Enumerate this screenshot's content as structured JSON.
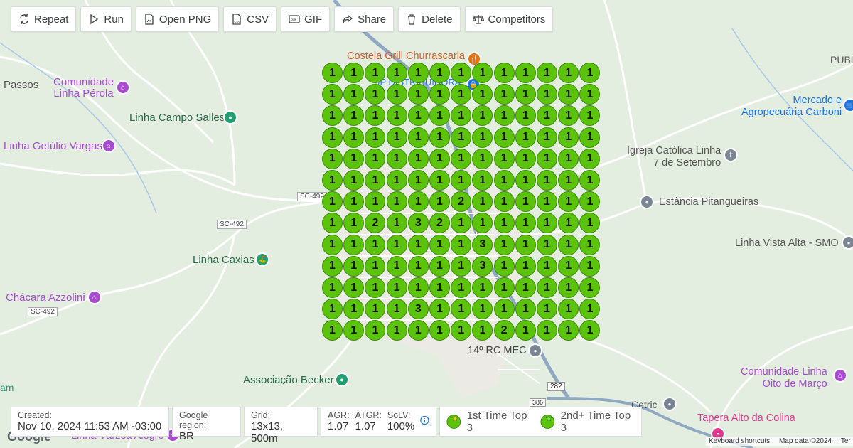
{
  "toolbar": {
    "repeat": "Repeat",
    "run": "Run",
    "open_png": "Open PNG",
    "csv": "CSV",
    "gif": "GIF",
    "share": "Share",
    "delete": "Delete",
    "competitors": "Competitors"
  },
  "map_labels": {
    "costela": "Costela Grill Churrascaria",
    "jp": "JP DISTRIBUIDORA",
    "comunidade_perola_1": "Comunidade",
    "comunidade_perola_2": "Linha Pérola",
    "passos": "Passos",
    "campo_salles": "Linha Campo Salles",
    "getulio": "Linha Getúlio Vargas",
    "caxias": "Linha Caxias",
    "chacara": "Chácara Azzolini",
    "sc492_a": "SC-492",
    "sc492_b": "SC-492",
    "sc492_c": "SC-492",
    "mercado_1": "Mercado e",
    "mercado_2": "Agropecuária Carboni",
    "igreja_1": "Igreja Católica Linha",
    "igreja_2": "7 de Setembro",
    "pitangueiras": "Estância Pitangueiras",
    "vista_alta": "Linha Vista Alta - SMO",
    "publi": "PUBL",
    "rc_mec": "14º RC MEC",
    "becker": "Associação Becker",
    "oito_marco_1": "Comunidade Linha",
    "oito_marco_2": "Oito de Março",
    "cetric": "Cetric",
    "tapera": "Tapera Alto da Colina",
    "varzea": "Linha Várzea Alegre",
    "am": "am",
    "road_282": "282",
    "road_386": "386",
    "google": "Google",
    "shortcuts": "Keyboard shortcuts",
    "mapdata": "Map data ©2024",
    "terms": "Ter"
  },
  "info": {
    "created_label": "Created:",
    "created_value": "Nov 10, 2024 11:53 AM -03:00",
    "region_label": "Google region:",
    "region_value": "BR",
    "grid_label": "Grid:",
    "grid_value": "13x13, 500m",
    "agr_label": "AGR:",
    "agr_value": "1.07",
    "atgr_label": "ATGR:",
    "atgr_value": "1.07",
    "solv_label": "SoLV:",
    "solv_value": "100%",
    "legend_first": "1st Time Top 3",
    "legend_second": "2nd+ Time Top 3"
  },
  "grid": {
    "cols": 13,
    "rows": 13,
    "pin_color": "#5cc30c",
    "ranks": [
      [
        1,
        1,
        1,
        1,
        1,
        1,
        1,
        1,
        1,
        1,
        1,
        1,
        1
      ],
      [
        1,
        1,
        1,
        1,
        1,
        1,
        1,
        1,
        1,
        1,
        1,
        1,
        1
      ],
      [
        1,
        1,
        1,
        1,
        1,
        1,
        1,
        1,
        1,
        1,
        1,
        1,
        1
      ],
      [
        1,
        1,
        1,
        1,
        1,
        1,
        1,
        1,
        1,
        1,
        1,
        1,
        1
      ],
      [
        1,
        1,
        1,
        1,
        1,
        1,
        1,
        1,
        1,
        1,
        1,
        1,
        1
      ],
      [
        1,
        1,
        1,
        1,
        1,
        1,
        1,
        1,
        1,
        1,
        1,
        1,
        1
      ],
      [
        1,
        1,
        1,
        1,
        1,
        1,
        2,
        1,
        1,
        1,
        1,
        1,
        1
      ],
      [
        1,
        1,
        2,
        1,
        3,
        2,
        1,
        1,
        1,
        1,
        1,
        1,
        1
      ],
      [
        1,
        1,
        1,
        1,
        1,
        1,
        1,
        3,
        1,
        1,
        1,
        1,
        1
      ],
      [
        1,
        1,
        1,
        1,
        1,
        1,
        1,
        3,
        1,
        1,
        1,
        1,
        1
      ],
      [
        1,
        1,
        1,
        1,
        1,
        1,
        1,
        1,
        1,
        1,
        1,
        1,
        1
      ],
      [
        1,
        1,
        1,
        1,
        3,
        1,
        1,
        1,
        1,
        1,
        1,
        1,
        1
      ],
      [
        1,
        1,
        1,
        1,
        1,
        1,
        1,
        1,
        2,
        1,
        1,
        1,
        1
      ]
    ]
  },
  "colors": {
    "map_bg": "#e6efe2",
    "road": "#ffffff",
    "highway": "#8fa9c2",
    "pin": "#5cc30c",
    "poi_green": "#1f9f6f",
    "poi_purple": "#a84bd0",
    "poi_pink": "#e0388f",
    "poi_gray": "#7b8694",
    "poi_blue": "#1a73e8",
    "poi_orange": "#e8710a"
  }
}
